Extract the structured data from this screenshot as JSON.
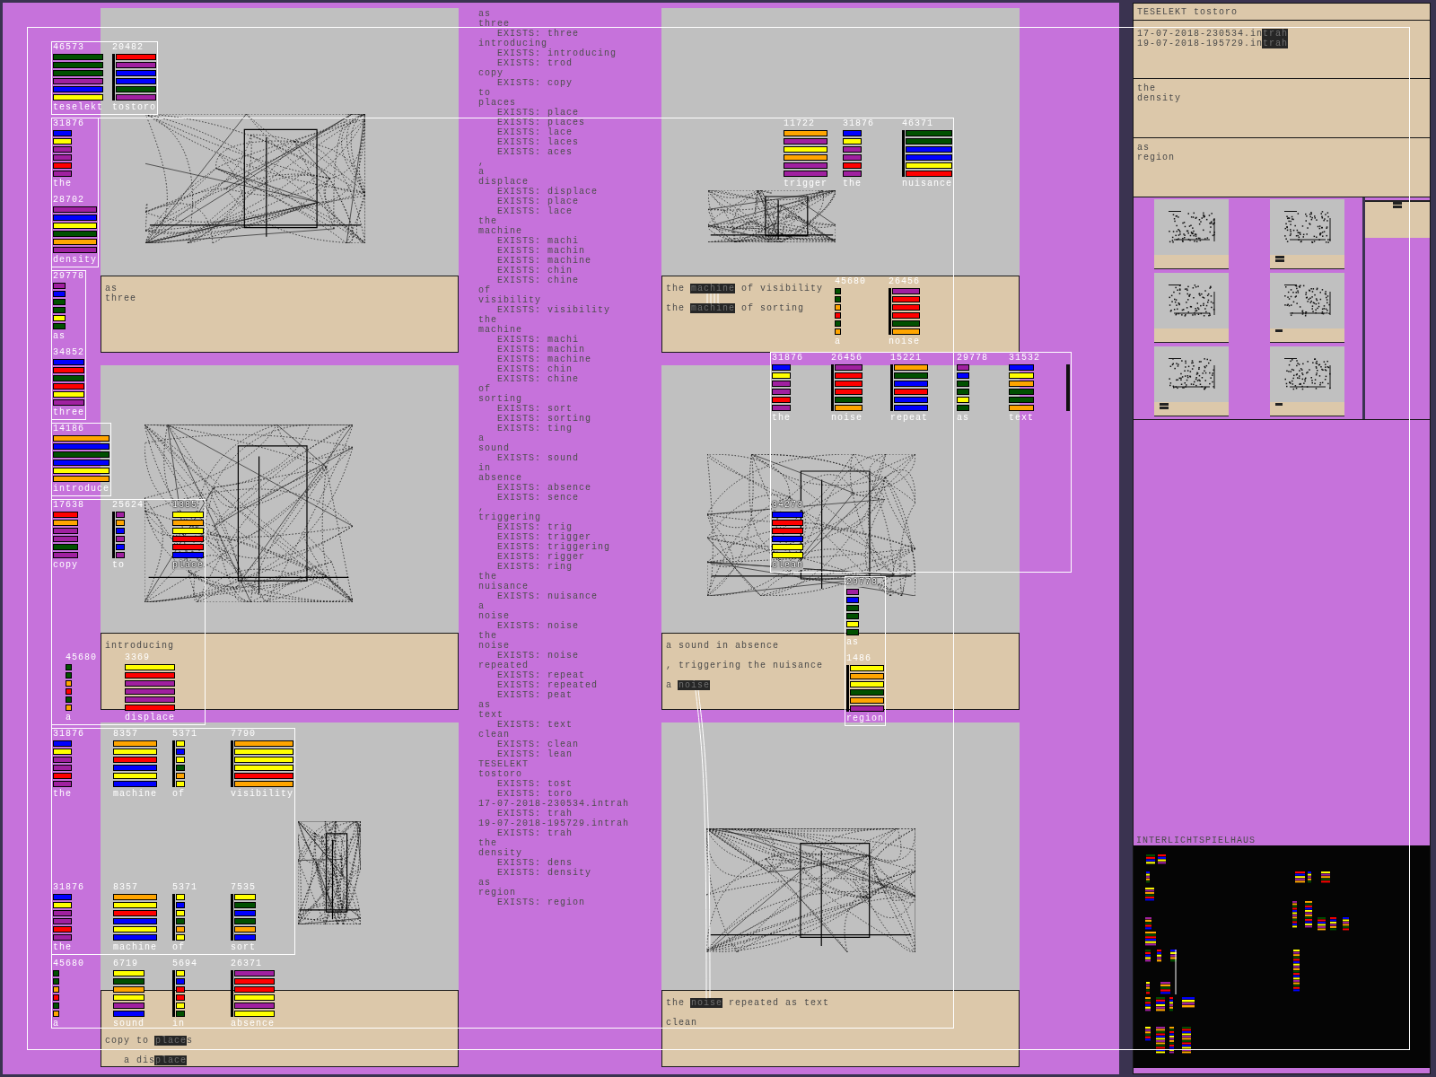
{
  "left_panels": [
    {
      "caption": [
        [
          [
            {
              "text": "as",
              "highlighted": false
            }
          ],
          [
            {
              "text": "three",
              "highlighted": false
            }
          ]
        ]
      ]
    },
    {
      "caption": [
        [
          [
            {
              "text": "introducing",
              "highlighted": false
            }
          ]
        ]
      ]
    },
    {
      "caption": [
        [
          [
            {
              "text": "copy to ",
              "highlighted": false
            },
            {
              "text": "place",
              "highlighted": true
            },
            {
              "text": "s",
              "highlighted": false
            }
          ]
        ],
        [
          [
            {
              "text": "a dis",
              "highlighted": false
            },
            {
              "text": "place",
              "highlighted": true
            }
          ]
        ]
      ]
    }
  ],
  "word_log": [
    {
      "text": "as"
    },
    {
      "text": "three",
      "children": [
        {
          "text": "EXISTS: three"
        }
      ]
    },
    {
      "text": "introducing",
      "children": [
        {
          "text": "EXISTS: introducing"
        },
        {
          "text": "EXISTS: trod"
        }
      ]
    },
    {
      "text": "copy",
      "children": [
        {
          "text": "EXISTS: copy"
        }
      ]
    },
    {
      "text": "to"
    },
    {
      "text": "places",
      "children": [
        {
          "text": "EXISTS: place"
        },
        {
          "text": "EXISTS: places"
        },
        {
          "text": "EXISTS: lace"
        },
        {
          "text": "EXISTS: laces"
        },
        {
          "text": "EXISTS: aces"
        }
      ]
    },
    {
      "text": ","
    },
    {
      "text": "a"
    },
    {
      "text": "displace",
      "children": [
        {
          "text": "EXISTS: displace"
        },
        {
          "text": "EXISTS: place"
        },
        {
          "text": "EXISTS: lace"
        }
      ]
    },
    {
      "text": "the"
    },
    {
      "text": "machine",
      "children": [
        {
          "text": "EXISTS: machi"
        },
        {
          "text": "EXISTS: machin"
        },
        {
          "text": "EXISTS: machine"
        },
        {
          "text": "EXISTS: chin"
        },
        {
          "text": "EXISTS: chine"
        }
      ]
    },
    {
      "text": "of"
    },
    {
      "text": "visibility",
      "children": [
        {
          "text": "EXISTS: visibility"
        }
      ]
    },
    {
      "text": "the"
    },
    {
      "text": "machine",
      "children": [
        {
          "text": "EXISTS: machi"
        },
        {
          "text": "EXISTS: machin"
        },
        {
          "text": "EXISTS: machine"
        },
        {
          "text": "EXISTS: chin"
        },
        {
          "text": "EXISTS: chine"
        }
      ]
    },
    {
      "text": "of"
    },
    {
      "text": "sorting",
      "children": [
        {
          "text": "EXISTS: sort"
        },
        {
          "text": "EXISTS: sorting"
        },
        {
          "text": "EXISTS: ting"
        }
      ]
    },
    {
      "text": "a"
    },
    {
      "text": "sound",
      "children": [
        {
          "text": "EXISTS: sound"
        }
      ]
    },
    {
      "text": "in"
    },
    {
      "text": "absence",
      "children": [
        {
          "text": "EXISTS: absence"
        },
        {
          "text": "EXISTS: sence"
        }
      ]
    },
    {
      "text": ","
    },
    {
      "text": "triggering",
      "children": [
        {
          "text": "EXISTS: trig"
        },
        {
          "text": "EXISTS: trigger"
        },
        {
          "text": "EXISTS: triggering"
        },
        {
          "text": "EXISTS: rigger"
        },
        {
          "text": "EXISTS: ring"
        }
      ]
    },
    {
      "text": "the"
    },
    {
      "text": "nuisance",
      "children": [
        {
          "text": "EXISTS: nuisance"
        }
      ]
    },
    {
      "text": "a"
    },
    {
      "text": "noise",
      "children": [
        {
          "text": "EXISTS: noise"
        }
      ]
    },
    {
      "text": "the"
    },
    {
      "text": "noise",
      "children": [
        {
          "text": "EXISTS: noise"
        }
      ]
    },
    {
      "text": "repeated",
      "children": [
        {
          "text": "EXISTS: repeat"
        },
        {
          "text": "EXISTS: repeated"
        },
        {
          "text": "EXISTS: peat"
        }
      ]
    },
    {
      "text": "as"
    },
    {
      "text": "text",
      "children": [
        {
          "text": "EXISTS: text"
        }
      ]
    },
    {
      "text": "clean",
      "children": [
        {
          "text": "EXISTS: clean"
        },
        {
          "text": "EXISTS: lean"
        }
      ]
    },
    {
      "text": "TESELEKT"
    },
    {
      "text": "tostoro",
      "children": [
        {
          "text": "EXISTS: tost"
        },
        {
          "text": "EXISTS: toro"
        }
      ]
    },
    {
      "text": "17-07-2018-230534.intrah",
      "children": [
        {
          "text": "EXISTS: trah"
        }
      ]
    },
    {
      "text": "19-07-2018-195729.intrah",
      "children": [
        {
          "text": "EXISTS: trah"
        }
      ]
    },
    {
      "text": "the"
    },
    {
      "text": "density",
      "children": [
        {
          "text": "EXISTS: dens"
        },
        {
          "text": "EXISTS: density"
        }
      ]
    },
    {
      "text": "as"
    },
    {
      "text": "region",
      "children": [
        {
          "text": "EXISTS: region"
        }
      ]
    }
  ],
  "right_panels": [
    {
      "caption": [
        [
          [
            {
              "text": "the ",
              "highlighted": false
            },
            {
              "text": "machine",
              "highlighted": true
            },
            {
              "text": " of visibility",
              "highlighted": false
            }
          ]
        ],
        [
          [
            {
              "text": "the ",
              "highlighted": false
            },
            {
              "text": "machine",
              "highlighted": true
            },
            {
              "text": " of sorting",
              "highlighted": false
            }
          ]
        ]
      ]
    },
    {
      "caption": [
        [
          [
            {
              "text": "a sound in absence",
              "highlighted": false
            }
          ]
        ],
        [
          [
            {
              "text": ", triggering the nuisance",
              "highlighted": false
            }
          ]
        ],
        [
          [
            {
              "text": "a ",
              "highlighted": false
            },
            {
              "text": "noise",
              "highlighted": true
            }
          ]
        ]
      ]
    },
    {
      "caption": [
        [
          [
            {
              "text": "the ",
              "highlighted": false
            },
            {
              "text": "noise",
              "highlighted": true
            },
            {
              "text": " repeated as text",
              "highlighted": false
            }
          ]
        ],
        [
          [
            {
              "text": "clean",
              "highlighted": false
            }
          ]
        ]
      ]
    }
  ],
  "stack_groups": [
    {
      "framed": true,
      "end_marker": false,
      "stacks": [
        {
          "count": "46573",
          "word": "teselekt",
          "bracketed": false,
          "bars": [
            {
              "color": "#005000"
            },
            {
              "color": "#005000"
            },
            {
              "color": "#005000"
            },
            {
              "color": "#a020a0"
            },
            {
              "color": "#0000ff"
            },
            {
              "color": "#ffff00"
            }
          ]
        },
        {
          "count": "20482",
          "word": "tostoro",
          "bracketed": true,
          "bars": [
            {
              "color": "#ff0000"
            },
            {
              "color": "#a020a0"
            },
            {
              "color": "#0000ff"
            },
            {
              "color": "#0000ff"
            },
            {
              "color": "#005000"
            },
            {
              "color": "#a020a0"
            }
          ]
        }
      ]
    },
    {
      "framed": true,
      "end_marker": false,
      "stacks": [
        {
          "count": "31876",
          "word": "the",
          "bracketed": false,
          "bars": [
            {
              "color": "#0000ff"
            },
            {
              "color": "#ffff00"
            },
            {
              "color": "#a020a0"
            },
            {
              "color": "#a020a0"
            },
            {
              "color": "#ff0000"
            },
            {
              "color": "#a020a0"
            }
          ]
        },
        {
          "count": "28702",
          "word": "density",
          "bracketed": false,
          "bars": [
            {
              "color": "#a020a0"
            },
            {
              "color": "#0000ff"
            },
            {
              "color": "#ffff00"
            },
            {
              "color": "#005000"
            },
            {
              "color": "#ffa500"
            },
            {
              "color": "#a020a0"
            }
          ]
        }
      ]
    },
    {
      "framed": true,
      "end_marker": false,
      "stacks": [
        {
          "count": "29778",
          "word": "as",
          "bracketed": false,
          "bars": [
            {
              "color": "#a020a0"
            },
            {
              "color": "#0000ff"
            },
            {
              "color": "#005000"
            },
            {
              "color": "#005000"
            },
            {
              "color": "#ffff00"
            },
            {
              "color": "#005000"
            }
          ]
        },
        {
          "count": "34852",
          "word": "three",
          "bracketed": false,
          "bars": [
            {
              "color": "#0000ff"
            },
            {
              "color": "#ff0000"
            },
            {
              "color": "#005000"
            },
            {
              "color": "#ff0000"
            },
            {
              "color": "#ffff00"
            },
            {
              "color": "#a020a0"
            }
          ]
        }
      ]
    },
    {
      "framed": true,
      "end_marker": false,
      "stacks": [
        {
          "count": "14186",
          "word": "introduce",
          "bracketed": false,
          "bars": [
            {
              "color": "#ffa500"
            },
            {
              "color": "#0000ff"
            },
            {
              "color": "#005000"
            },
            {
              "color": "#0000ff"
            },
            {
              "color": "#ffff00"
            },
            {
              "color": "#ffa500"
            }
          ]
        }
      ]
    },
    {
      "framed": true,
      "end_marker": false,
      "stacks": [
        {
          "count": "17638",
          "word": "copy",
          "bracketed": false,
          "bars": [
            {
              "color": "#ff0000"
            },
            {
              "color": "#ffa500"
            },
            {
              "color": "#a020a0"
            },
            {
              "color": "#a020a0"
            },
            {
              "color": "#005000"
            },
            {
              "color": "#a020a0"
            }
          ]
        },
        {
          "count": "25624",
          "word": "to",
          "bracketed": true,
          "bars": [
            {
              "color": "#a020a0"
            },
            {
              "color": "#ffa500"
            },
            {
              "color": "#0000ff"
            },
            {
              "color": "#a020a0"
            },
            {
              "color": "#0000ff"
            },
            {
              "color": "#a020a0"
            }
          ]
        },
        {
          "count": "1385",
          "word": "place",
          "bracketed": false,
          "bars": [
            {
              "color": "#ffff00"
            },
            {
              "color": "#ffa500"
            },
            {
              "color": "#ffff00"
            },
            {
              "color": "#ff0000"
            },
            {
              "color": "#ff0000"
            },
            {
              "color": "#0000ff"
            }
          ]
        },
        {
          "count": "45680",
          "word": "a",
          "bracketed": false,
          "bars": [
            {
              "color": "#005000"
            },
            {
              "color": "#005000"
            },
            {
              "color": "#ffa500"
            },
            {
              "color": "#ff0000"
            },
            {
              "color": "#005000"
            },
            {
              "color": "#ffa500"
            }
          ]
        },
        {
          "count": "3369",
          "word": "displace",
          "bracketed": false,
          "bars": [
            {
              "color": "#ffff00"
            },
            {
              "color": "#ff0000"
            },
            {
              "color": "#a020a0"
            },
            {
              "color": "#a020a0"
            },
            {
              "color": "#a020a0"
            },
            {
              "color": "#ff0000"
            }
          ]
        }
      ]
    },
    {
      "framed": true,
      "end_marker": false,
      "stacks": [
        {
          "count": "31876",
          "word": "the",
          "bracketed": false,
          "bars": [
            {
              "color": "#0000ff"
            },
            {
              "color": "#ffff00"
            },
            {
              "color": "#a020a0"
            },
            {
              "color": "#a020a0"
            },
            {
              "color": "#ff0000"
            },
            {
              "color": "#a020a0"
            }
          ]
        },
        {
          "count": "8357",
          "word": "machine",
          "bracketed": false,
          "bars": [
            {
              "color": "#ffa500"
            },
            {
              "color": "#ffff00"
            },
            {
              "color": "#ff0000"
            },
            {
              "color": "#0000ff"
            },
            {
              "color": "#ffff00"
            },
            {
              "color": "#0000ff"
            }
          ]
        },
        {
          "count": "5371",
          "word": "of",
          "bracketed": true,
          "bars": [
            {
              "color": "#ffff00"
            },
            {
              "color": "#0000ff"
            },
            {
              "color": "#ffff00"
            },
            {
              "color": "#005000"
            },
            {
              "color": "#ffa500"
            },
            {
              "color": "#ffff00"
            }
          ]
        },
        {
          "count": "7790",
          "word": "visibility",
          "bracketed": true,
          "bars": [
            {
              "color": "#ffa500"
            },
            {
              "color": "#ffff00"
            },
            {
              "color": "#ffff00"
            },
            {
              "color": "#ffff00"
            },
            {
              "color": "#ff0000"
            },
            {
              "color": "#ffa500"
            }
          ]
        },
        {
          "count": "31876",
          "word": "the",
          "bracketed": false,
          "bars": [
            {
              "color": "#0000ff"
            },
            {
              "color": "#ffff00"
            },
            {
              "color": "#a020a0"
            },
            {
              "color": "#a020a0"
            },
            {
              "color": "#ff0000"
            },
            {
              "color": "#a020a0"
            }
          ]
        },
        {
          "count": "8357",
          "word": "machine",
          "bracketed": false,
          "bars": [
            {
              "color": "#ffa500"
            },
            {
              "color": "#ffff00"
            },
            {
              "color": "#ff0000"
            },
            {
              "color": "#0000ff"
            },
            {
              "color": "#ffff00"
            },
            {
              "color": "#0000ff"
            }
          ]
        },
        {
          "count": "5371",
          "word": "of",
          "bracketed": true,
          "bars": [
            {
              "color": "#ffff00"
            },
            {
              "color": "#0000ff"
            },
            {
              "color": "#ffff00"
            },
            {
              "color": "#005000"
            },
            {
              "color": "#ffa500"
            },
            {
              "color": "#ffff00"
            }
          ]
        },
        {
          "count": "7535",
          "word": "sort",
          "bracketed": true,
          "bars": [
            {
              "color": "#ffff00"
            },
            {
              "color": "#005000"
            },
            {
              "color": "#0000ff"
            },
            {
              "color": "#005000"
            },
            {
              "color": "#ffa500"
            },
            {
              "color": "#0000ff"
            }
          ]
        }
      ]
    },
    {
      "framed": false,
      "end_marker": false,
      "stacks": [
        {
          "count": "45680",
          "word": "a",
          "bracketed": false,
          "bars": [
            {
              "color": "#005000"
            },
            {
              "color": "#005000"
            },
            {
              "color": "#ffa500"
            },
            {
              "color": "#ff0000"
            },
            {
              "color": "#005000"
            },
            {
              "color": "#ffa500"
            }
          ]
        },
        {
          "count": "6719",
          "word": "sound",
          "bracketed": false,
          "bars": [
            {
              "color": "#ffff00"
            },
            {
              "color": "#005000"
            },
            {
              "color": "#ffa500"
            },
            {
              "color": "#ffff00"
            },
            {
              "color": "#a020a0"
            },
            {
              "color": "#0000ff"
            }
          ]
        },
        {
          "count": "5694",
          "word": "in",
          "bracketed": true,
          "bars": [
            {
              "color": "#ffff00"
            },
            {
              "color": "#0000ff"
            },
            {
              "color": "#ff0000"
            },
            {
              "color": "#ff0000"
            },
            {
              "color": "#ffff00"
            },
            {
              "color": "#005000"
            }
          ]
        },
        {
          "count": "26371",
          "word": "absence",
          "bracketed": true,
          "bars": [
            {
              "color": "#a020a0"
            },
            {
              "color": "#ff0000"
            },
            {
              "color": "#ff0000"
            },
            {
              "color": "#ffff00"
            },
            {
              "color": "#a020a0"
            },
            {
              "color": "#ffff00"
            }
          ]
        }
      ]
    },
    {
      "framed": false,
      "end_marker": false,
      "stacks": [
        {
          "count": "11722",
          "word": "trigger",
          "bracketed": false,
          "bars": [
            {
              "color": "#ffa500"
            },
            {
              "color": "#a020a0"
            },
            {
              "color": "#ffff00"
            },
            {
              "color": "#ffa500"
            },
            {
              "color": "#a020a0"
            },
            {
              "color": "#a020a0"
            }
          ]
        },
        {
          "count": "31876",
          "word": "the",
          "bracketed": false,
          "bars": [
            {
              "color": "#0000ff"
            },
            {
              "color": "#ffff00"
            },
            {
              "color": "#a020a0"
            },
            {
              "color": "#a020a0"
            },
            {
              "color": "#ff0000"
            },
            {
              "color": "#a020a0"
            }
          ]
        },
        {
          "count": "46371",
          "word": "nuisance",
          "bracketed": true,
          "bars": [
            {
              "color": "#005000"
            },
            {
              "color": "#005000"
            },
            {
              "color": "#0000ff"
            },
            {
              "color": "#0000ff"
            },
            {
              "color": "#ffff00"
            },
            {
              "color": "#ff0000"
            }
          ]
        }
      ]
    },
    {
      "framed": false,
      "end_marker": false,
      "stacks": [
        {
          "count": "45680",
          "word": "a",
          "bracketed": false,
          "bars": [
            {
              "color": "#005000"
            },
            {
              "color": "#005000"
            },
            {
              "color": "#ffa500"
            },
            {
              "color": "#ff0000"
            },
            {
              "color": "#005000"
            },
            {
              "color": "#ffa500"
            }
          ]
        },
        {
          "count": "26456",
          "word": "noise",
          "bracketed": true,
          "bars": [
            {
              "color": "#a020a0"
            },
            {
              "color": "#ff0000"
            },
            {
              "color": "#ff0000"
            },
            {
              "color": "#ff0000"
            },
            {
              "color": "#005000"
            },
            {
              "color": "#ffa500"
            }
          ]
        }
      ]
    },
    {
      "framed": true,
      "end_marker": true,
      "stacks": [
        {
          "count": "31876",
          "word": "the",
          "bracketed": false,
          "bars": [
            {
              "color": "#0000ff"
            },
            {
              "color": "#ffff00"
            },
            {
              "color": "#a020a0"
            },
            {
              "color": "#a020a0"
            },
            {
              "color": "#ff0000"
            },
            {
              "color": "#a020a0"
            }
          ]
        },
        {
          "count": "26456",
          "word": "noise",
          "bracketed": true,
          "bars": [
            {
              "color": "#a020a0"
            },
            {
              "color": "#ff0000"
            },
            {
              "color": "#ff0000"
            },
            {
              "color": "#ff0000"
            },
            {
              "color": "#005000"
            },
            {
              "color": "#ffa500"
            }
          ]
        },
        {
          "count": "15221",
          "word": "repeat",
          "bracketed": true,
          "bars": [
            {
              "color": "#ffa500"
            },
            {
              "color": "#005000"
            },
            {
              "color": "#0000ff"
            },
            {
              "color": "#ff0000"
            },
            {
              "color": "#0000ff"
            },
            {
              "color": "#0000ff"
            }
          ]
        },
        {
          "count": "29778",
          "word": "as",
          "bracketed": false,
          "bars": [
            {
              "color": "#a020a0"
            },
            {
              "color": "#0000ff"
            },
            {
              "color": "#005000"
            },
            {
              "color": "#005000"
            },
            {
              "color": "#ffff00"
            },
            {
              "color": "#005000"
            }
          ]
        },
        {
          "count": "31532",
          "word": "text",
          "bracketed": false,
          "bars": [
            {
              "color": "#0000ff"
            },
            {
              "color": "#ffff00"
            },
            {
              "color": "#ffa500"
            },
            {
              "color": "#005000"
            },
            {
              "color": "#005000"
            },
            {
              "color": "#ffa500"
            }
          ]
        },
        {
          "count": "34273",
          "word": "clean",
          "bracketed": false,
          "bars": [
            {
              "color": "#0000ff"
            },
            {
              "color": "#ff0000"
            },
            {
              "color": "#ff0000"
            },
            {
              "color": "#0000ff"
            },
            {
              "color": "#ffff00"
            },
            {
              "color": "#ffff00"
            }
          ]
        }
      ]
    },
    {
      "framed": true,
      "end_marker": false,
      "stacks": [
        {
          "count": "29778",
          "word": "as",
          "bracketed": false,
          "bars": [
            {
              "color": "#a020a0"
            },
            {
              "color": "#0000ff"
            },
            {
              "color": "#005000"
            },
            {
              "color": "#005000"
            },
            {
              "color": "#ffff00"
            },
            {
              "color": "#005000"
            }
          ]
        },
        {
          "count": "1486",
          "word": "region",
          "bracketed": true,
          "bars": [
            {
              "color": "#ffff00"
            },
            {
              "color": "#ffa500"
            },
            {
              "color": "#ffff00"
            },
            {
              "color": "#005000"
            },
            {
              "color": "#ffa500"
            },
            {
              "color": "#a020a0"
            }
          ]
        }
      ]
    }
  ],
  "sidebar": {
    "title": "TESELEKT tostoro",
    "sections": [
      [
        [
          {
            "text": "17-07-2018-230534.in",
            "highlighted": false
          },
          {
            "text": "trah",
            "highlighted": true
          }
        ],
        [
          {
            "text": "19-07-2018-195729.in",
            "highlighted": false
          },
          {
            "text": "trah",
            "highlighted": true
          }
        ]
      ],
      [
        [
          {
            "text": "the",
            "highlighted": false
          }
        ],
        [
          {
            "text": "density",
            "highlighted": false
          }
        ]
      ],
      [
        [
          {
            "text": "as",
            "highlighted": false
          }
        ],
        [
          {
            "text": "region",
            "highlighted": false
          }
        ]
      ]
    ],
    "gallery": [
      {
        "kind": "blank"
      },
      {
        "kind": "double-dash"
      },
      {
        "kind": "blank"
      },
      {
        "kind": "dash"
      },
      {
        "kind": "double-dash"
      },
      {
        "kind": "dash"
      }
    ],
    "map_title": "INTERLICHTSPIELHAUS"
  }
}
